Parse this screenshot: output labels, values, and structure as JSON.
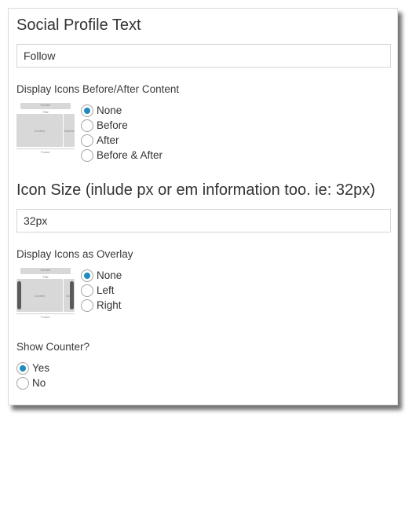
{
  "social_profile": {
    "title": "Social Profile Text",
    "value": "Follow"
  },
  "display_icons": {
    "label": "Display Icons Before/After Content",
    "options": [
      "None",
      "Before",
      "After",
      "Before & After"
    ],
    "selected": "None",
    "thumb": {
      "header": "Header",
      "title": "Title",
      "content": "Content",
      "sidebar": "Sidebar",
      "footer": "Footer"
    }
  },
  "icon_size": {
    "title": "Icon Size (inlude px or em information too. ie: 32px)",
    "value": "32px"
  },
  "overlay": {
    "label": "Display Icons as Overlay",
    "options": [
      "None",
      "Left",
      "Right"
    ],
    "selected": "None",
    "thumb": {
      "header": "Header",
      "title": "Title",
      "content": "Content",
      "sidebar": "Side",
      "footer": "Footer"
    }
  },
  "counter": {
    "label": "Show Counter?",
    "options": [
      "Yes",
      "No"
    ],
    "selected": "Yes"
  }
}
